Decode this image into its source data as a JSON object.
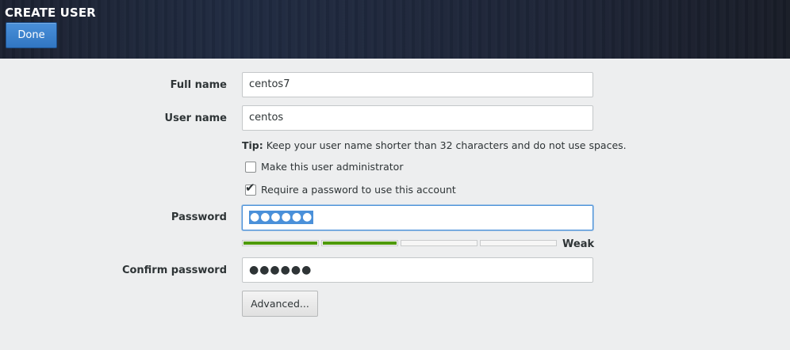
{
  "header": {
    "title": "CREATE USER",
    "done_label": "Done"
  },
  "form": {
    "full_name": {
      "label": "Full name",
      "value": "centos7"
    },
    "user_name": {
      "label": "User name",
      "value": "centos"
    },
    "tip": {
      "prefix": "Tip:",
      "text": " Keep your user name shorter than 32 characters and do not use spaces."
    },
    "admin_checkbox": {
      "label": "Make this user administrator",
      "checked": false
    },
    "require_password_checkbox": {
      "label": "Require a password to use this account",
      "checked": true
    },
    "password": {
      "label": "Password",
      "masked_value": "●●●●●●"
    },
    "strength": {
      "label": "Weak",
      "level": 0.5,
      "segments": 4
    },
    "confirm_password": {
      "label": "Confirm password",
      "masked_value": "●●●●●●"
    },
    "advanced_label": "Advanced..."
  },
  "colors": {
    "accent": "#4a90d9",
    "strength_fill": "#4e9a06",
    "background": "#edeeef"
  }
}
